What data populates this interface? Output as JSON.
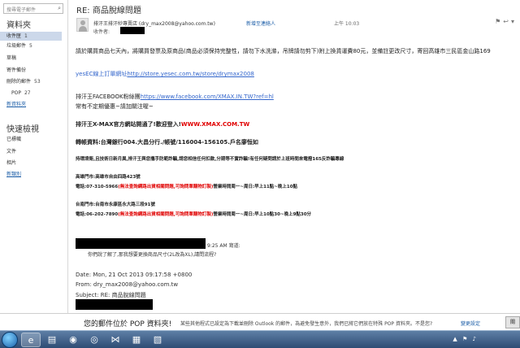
{
  "sidebar": {
    "search_placeholder": "搜尋電子郵件",
    "folders_heading": "資料夾",
    "items": [
      {
        "label": "收件匣",
        "count": "1"
      },
      {
        "label": "垃圾郵件",
        "count": "5"
      },
      {
        "label": "草稿",
        "count": ""
      },
      {
        "label": "寄件備份",
        "count": ""
      },
      {
        "label": "刪除的郵件",
        "count": "53"
      },
      {
        "label": "POP",
        "count": "27"
      },
      {
        "label": "新資料夾",
        "count": ""
      }
    ],
    "quick_heading": "快速檢視",
    "quick_items": [
      "已標幟",
      "文件",
      "相片",
      "新類別"
    ]
  },
  "message": {
    "subject": "RE: 商品脫線問題",
    "from": "排汗王排汗紗專賣店 (dry_max2008@yahoo.com.tw)",
    "add_contact": "新增至連絡人",
    "time": "上午 10:03",
    "to_label": "收件者:",
    "body": {
      "p1": "請於購買商品七天內，將購買發票及原商品(商品必須保持完整性，請勿下水洗滌，吊牌請勿剪下)附上換貨運費80元，並備註更改尺寸，寄回高雄市三民區金山路169",
      "p2_label": "yesEC線上訂單網址",
      "p2_link": "http://store.yesec.com.tw/store/drymax2008",
      "p3_label": "排汗王FACEBOOK粉絲團",
      "p3_link": "https://www.facebook.com/XMAX.IN.TW?ref=hl",
      "p3_sub": "常有不定期優惠~請加關注喔~",
      "p4_label": "排汗王X-MAX官方網站開通了!歡迎登入!",
      "p4_link": "WWW.XMAX.COM.TW",
      "p5": "轉帳資料:台灣銀行004.大昌分行./帳號/116004-156105.戶名廖恒如",
      "p6": "持環境衛,且技術日新月異,排汗王與您攜手防範詐騙,請您相信任何扣款,分期等不實詐騙!有任何疑問請於上班時間來電撥165反詐騙專線",
      "store1_name": "高雄門市:高雄市自由四路423號",
      "store1_phone": "電話:07-310-5966",
      "store1_note": "(無法查詢網路出貨相關問題,可詢問單購物訂製)",
      "store1_hours": "營業時間周一~周日:早上11點~晚上10點",
      "store2_name": "台南門市:台南市永康區永大路三段91號",
      "store2_phone": "電話:06-202-7890",
      "store2_note": "(無法查詢網路出貨相關問題,可詢問單購物訂製)",
      "store2_hours": "營業時間周一~周日:早上10點30~晚上9點30分"
    },
    "quoted_time": "9:25 AM 寫道:",
    "quoted_text": "你們說了解了,那我想要更換商品尺寸(2L改為XL),請問流程?",
    "hdr_date": "Date: Mon, 21 Oct 2013 09:17:58 +0800",
    "hdr_from": "From: dry_max2008@yahoo.com.tw",
    "hdr_subject": "Subject: RE: 商品脫線問題"
  },
  "pop_bar": {
    "title": "您的郵件位於 POP 資料夾!",
    "desc": "某些其他程式已設定為下載並刪除 Outlook 的郵件，為避免發生意外，我們已將它們放在特殊 POP 資料夾。不是您?",
    "link": "變更設定",
    "close": "關"
  },
  "taskbar": {
    "time": "",
    "date": ""
  },
  "colors": {
    "accent": "#1e5fa8",
    "red": "#e00000",
    "link": "#3366cc",
    "taskbar": "#2e4c74"
  }
}
